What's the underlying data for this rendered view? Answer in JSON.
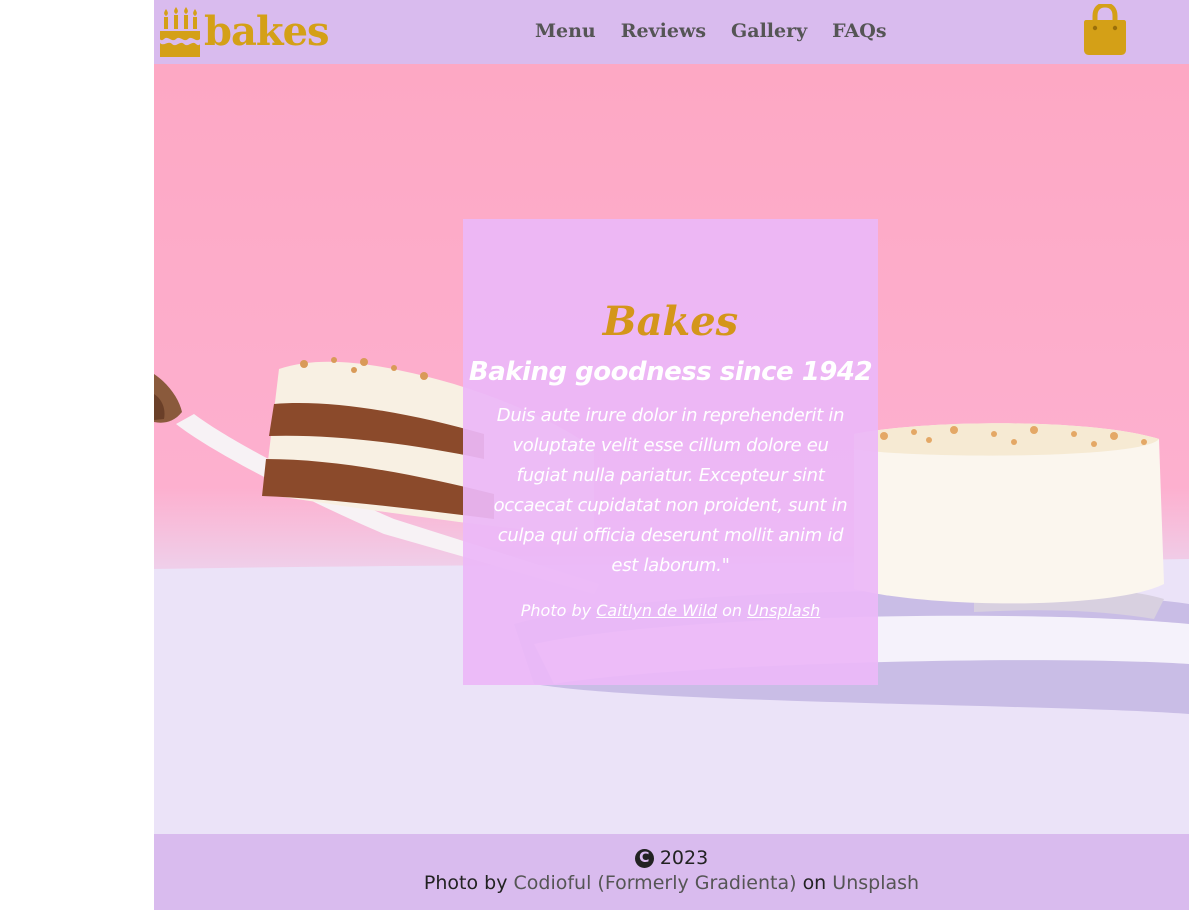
{
  "header": {
    "logo_text": "bakes",
    "logo_icon": "birthday-cake-icon",
    "nav": [
      {
        "label": "Menu"
      },
      {
        "label": "Reviews"
      },
      {
        "label": "Gallery"
      },
      {
        "label": "FAQs"
      }
    ],
    "cart_icon": "shopping-bag-icon"
  },
  "hero": {
    "image": "cake-slice-photo",
    "card": {
      "title": "Bakes",
      "subtitle": "Baking goodness since 1942",
      "body": "Duis aute irure dolor in reprehenderit in voluptate velit esse cillum dolore eu fugiat nulla pariatur. Excepteur sint occaecat cupidatat non proident, sunt in culpa qui officia deserunt mollit anim id est laborum.\"",
      "credit_prefix": "Photo by",
      "credit_author": "Caitlyn de Wild",
      "credit_middle": "on",
      "credit_site": "Unsplash"
    }
  },
  "footer": {
    "copyright_symbol": "C",
    "year": "2023",
    "credit_prefix": "Photo by",
    "credit_author": "Codioful (Formerly Gradienta)",
    "credit_middle": "on",
    "credit_site": "Unsplash"
  },
  "colors": {
    "header_bg": "#d9bbee",
    "accent_gold": "#d4a017",
    "nav_text": "#555555",
    "card_bg": "#ecb8f8",
    "hero_pink": "#fda8c4"
  }
}
